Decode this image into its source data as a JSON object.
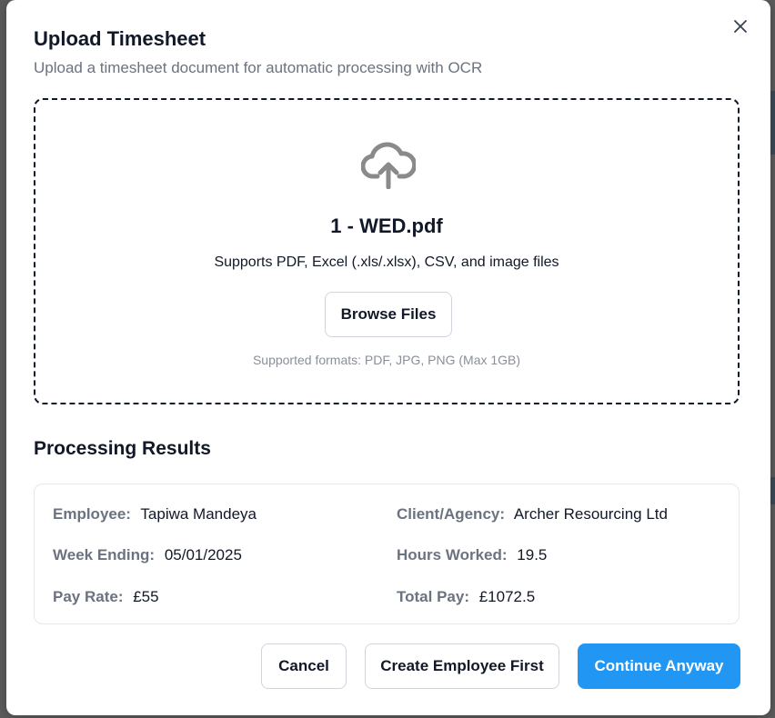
{
  "dialog": {
    "title": "Upload Timesheet",
    "subtitle": "Upload a timesheet document for automatic processing with OCR",
    "close_icon": "close-icon"
  },
  "dropzone": {
    "icon": "cloud-upload-icon",
    "filename": "1 - WED.pdf",
    "supports_text": "Supports PDF, Excel (.xls/.xlsx), CSV, and image files",
    "browse_label": "Browse Files",
    "formats_text": "Supported formats: PDF, JPG, PNG (Max 1GB)"
  },
  "results": {
    "title": "Processing Results",
    "employee": {
      "label": "Employee:",
      "value": "Tapiwa Mandeya"
    },
    "client": {
      "label": "Client/Agency:",
      "value": "Archer Resourcing Ltd"
    },
    "week_ending": {
      "label": "Week Ending:",
      "value": "05/01/2025"
    },
    "hours": {
      "label": "Hours Worked:",
      "value": "19.5"
    },
    "pay_rate": {
      "label": "Pay Rate:",
      "value": "£55"
    },
    "total_pay": {
      "label": "Total Pay:",
      "value": "£1072.5"
    }
  },
  "actions": {
    "cancel": "Cancel",
    "create_employee": "Create Employee First",
    "continue": "Continue Anyway"
  },
  "colors": {
    "primary": "#2196f3",
    "label": "#6b7280",
    "text": "#111827"
  }
}
